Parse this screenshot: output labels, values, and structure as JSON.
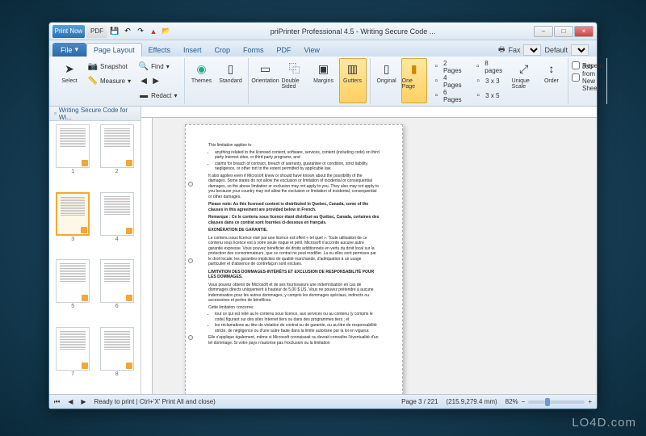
{
  "window": {
    "title": "priPrinter Professional 4.5 - Writing Secure Code ...",
    "qat_print": "Print Now",
    "qat_pdf": "PDF"
  },
  "wincontrols": {
    "min": "–",
    "max": "□",
    "close": "×"
  },
  "file_menu": "File",
  "tabs": [
    "Page Layout",
    "Effects",
    "Insert",
    "Crop",
    "Forms",
    "PDF",
    "View"
  ],
  "ribbon_right": {
    "fax_label": "Fax",
    "default_label": "Default"
  },
  "ribbon": {
    "select": {
      "select": "Select",
      "snapshot": "Snapshot",
      "measure": "Measure"
    },
    "find": {
      "find": "Find",
      "redact": "Redact"
    },
    "themes": "Themes",
    "standard": "Standard",
    "orientation": "Orientation",
    "double": "Double Sided",
    "margins": "Margins",
    "gutters": "Gutters",
    "original": "Original",
    "onepage": "One Page",
    "grid": {
      "p2": "2 Pages",
      "p4": "4 Pages",
      "p6": "6 Pages",
      "p8": "8 pages",
      "g33": "3 x 3",
      "g35": "3 x 5"
    },
    "unique": "Unique Scale",
    "order": "Order",
    "repeat": "Repeat",
    "newsheet": "Job from New Sheet"
  },
  "thumbs": {
    "tab": "Writing Secure Code for Wi...",
    "pages": [
      1,
      2,
      3,
      4,
      5,
      6,
      7,
      8
    ],
    "selected": 3
  },
  "doc": {
    "heading1": "This limitation applies to",
    "bullets1": [
      "anything related to the licensed content, software, services, content (including code) on third party Internet sites, or third party programs; and",
      "claims for breach of contract, breach of warranty, guarantee or condition, strict liability, negligence, or other tort to the extent permitted by applicable law."
    ],
    "para1": "It also applies even if Microsoft knew or should have known about the possibility of the damages. Some states do not allow the exclusion or limitation of incidental or consequential damages, so the above limitation or exclusion may not apply to you. They also may not apply to you because your country may not allow the exclusion or limitation of incidental, consequential or other damages.",
    "bold1": "Please note: As this licensed content is distributed in Quebec, Canada, some of the clauses in this agreement are provided below in French.",
    "bold2": "Remarque : Ce le contenu sous licence étant distribué au Québec, Canada, certaines des clauses dans ce contrat sont fournies ci-dessous en français.",
    "h2": "EXONÉRATION DE GARANTIE.",
    "para2": "Le contenu sous licence visé par une licence est offert « tel quel ». Toute utilisation de ce contenu sous licence est à votre seule risque et péril. Microsoft n'accorde aucune autre garantie expresse. Vous pouvez bénéficier de droits additionnels en vertu du droit local sur la protection des consommateurs, que ce contrat ne peut modifier. La ou elles sont permises par le droit locale, les garanties implicites de qualité marchande, d'adéquation à un usage particulier et d'absence de contrefaçon sont exclues.",
    "h3": "LIMITATION DES DOMMAGES-INTÉRÊTS ET EXCLUSION DE RESPONSABILITÉ POUR LES DOMMAGES.",
    "para3": "Vous pouvez obtenir de Microsoft et de ses fournisseurs une indemnisation en cas de dommages directs uniquement à hauteur de 5,00 $ US. Vous ne pouvez prétendre à aucune indemnisation pour les autres dommages, y compris les dommages spéciaux, indirects ou accessoires et pertes de bénéfices.",
    "para4": "Cette limitation concerne:",
    "bullets2": [
      "tout ce qui est relié au le contenu sous licence, aux services ou au contenu (y compris le code) figurant sur des sites Internet tiers ou dans des programmes tiers ; et",
      "les réclamations au titre de violation de contrat ou de garantie, ou au titre de responsabilité stricte, de négligence ou d'une autre faute dans la limite autorisée par la loi en vigueur."
    ],
    "para5": "Elle s'applique également, même si Microsoft connaissait ou devrait connaître l'éventualité d'un tel dommage. Si votre pays n'autorise pas l'exclusion ou la limitation"
  },
  "status": {
    "ready": "Ready to print | Ctrl+'X' Print All and close)",
    "page": "Page 3 / 221",
    "size": "(215.9,279.4 mm)",
    "zoom": "82%"
  },
  "watermark": "LO4D.com"
}
